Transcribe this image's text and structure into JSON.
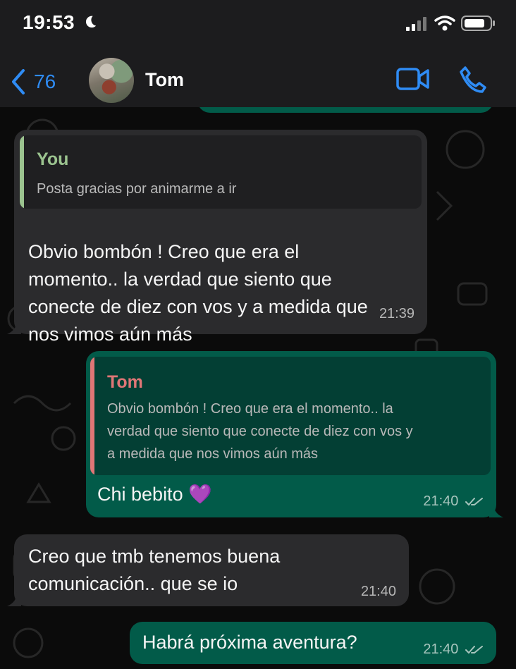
{
  "status_bar": {
    "time": "19:53",
    "icons": [
      "moon-icon",
      "signal-icon",
      "wifi-icon",
      "battery-icon"
    ]
  },
  "header": {
    "back_count": "76",
    "contact_name": "Tom",
    "actions": [
      "video-call-icon",
      "phone-call-icon"
    ]
  },
  "colors": {
    "accent": "#2f8cf5",
    "outgoing_bubble": "#025b49",
    "incoming_bubble": "#2b2b2d",
    "quote_you": "#9bc38f",
    "quote_tom": "#e07676"
  },
  "messages": [
    {
      "direction": "incoming",
      "quote": {
        "author": "You",
        "text": "Posta gracias por animarme a ir"
      },
      "lines": [
        "Obvio bombón ! Creo que era el",
        "momento.. la verdad que siento que",
        "conecte de diez con vos y a medida que",
        "nos vimos aún más"
      ],
      "time": "21:39"
    },
    {
      "direction": "outgoing",
      "quote": {
        "author": "Tom",
        "lines": [
          "Obvio bombón ! Creo que era el momento.. la",
          "verdad que siento que conecte de diez con vos y",
          "a medida que nos vimos aún más"
        ]
      },
      "text": "Chi bebito 💜",
      "time": "21:40",
      "status": "double-check-icon"
    },
    {
      "direction": "incoming",
      "lines": [
        "Creo que tmb tenemos buena",
        "comunicación.. que se io"
      ],
      "time": "21:40"
    },
    {
      "direction": "outgoing",
      "text": "Habrá próxima aventura?",
      "time": "21:40",
      "status": "double-check-icon"
    }
  ]
}
